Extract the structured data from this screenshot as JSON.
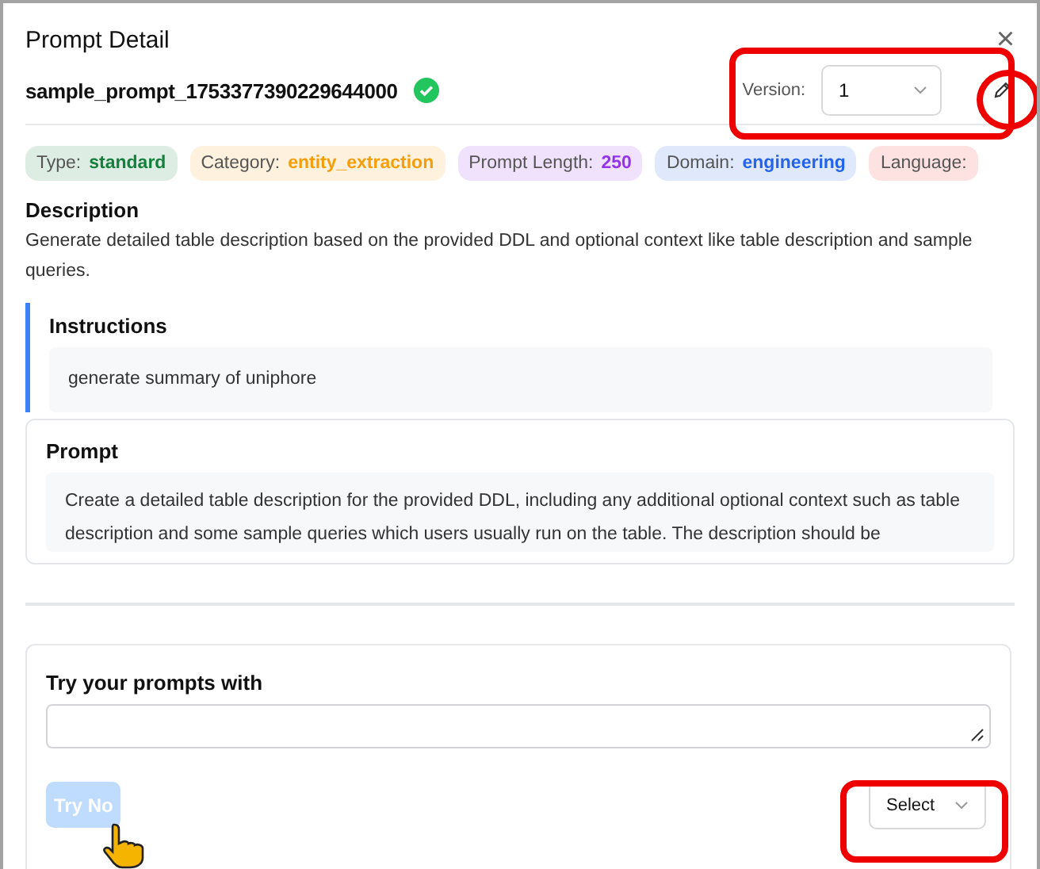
{
  "dialog": {
    "title": "Prompt Detail",
    "close": "×"
  },
  "prompt": {
    "name": "sample_prompt_1753377390229644000",
    "verified": true,
    "version_label": "Version:",
    "version": "1"
  },
  "tags": [
    {
      "label": "Type:",
      "value": "standard",
      "color": "#15803d"
    },
    {
      "label": "Category:",
      "value": "entity_extraction",
      "color": "#f59e0b"
    },
    {
      "label": "Prompt Length:",
      "value": "250",
      "color": "#9333ea"
    },
    {
      "label": "Domain:",
      "value": "engineering",
      "color": "#2563eb"
    },
    {
      "label": "Language:",
      "color": "#fee2e2"
    }
  ],
  "description": {
    "heading": "Description",
    "text": "Generate detailed table description based on the provided DDL and optional context like table description and sample queries."
  },
  "instructions": {
    "heading": "Instructions",
    "text": "generate summary of uniphore"
  },
  "prompt_body": {
    "heading": "Prompt",
    "text": "Create a detailed table description for the provided DDL, including any additional optional context such as table description and some sample queries which users usually run on the table. The description should be"
  },
  "try": {
    "heading": "Try your prompts with",
    "try_button": "Try No",
    "try_disabled": true,
    "select_placeholder": "Select"
  }
}
